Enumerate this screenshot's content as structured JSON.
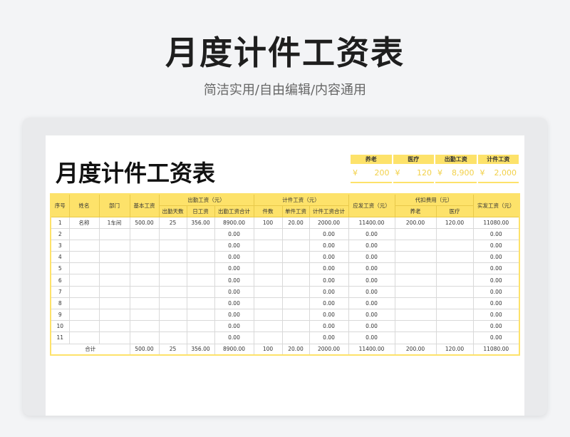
{
  "page": {
    "title": "月度计件工资表",
    "subtitle": "简洁实用/自由编辑/内容通用"
  },
  "sheet": {
    "title": "月度计件工资表",
    "summary": {
      "labels": [
        "养老",
        "医疗",
        "出勤工资",
        "计件工资"
      ],
      "currency": "¥",
      "values": [
        "200",
        "120",
        "8,900",
        "2,000"
      ]
    }
  },
  "table": {
    "headers": {
      "seq": "序号",
      "name": "姓名",
      "dept": "部门",
      "base": "基本工资",
      "attendance_group": "出勤工资（元）",
      "att_days": "出勤天数",
      "daily": "日工资",
      "att_total": "出勤工资合计",
      "piece_group": "计件工资（元）",
      "pieces": "件数",
      "unit": "单件工资",
      "piece_total": "计件工资合计",
      "gross": "应发工资（元）",
      "deduct_group": "代扣费用（元）",
      "pension": "养老",
      "medical": "医疗",
      "net": "实发工资（元）"
    },
    "rows": [
      [
        "1",
        "名称",
        "1车间",
        "500.00",
        "25",
        "356.00",
        "8900.00",
        "100",
        "20.00",
        "2000.00",
        "11400.00",
        "200.00",
        "120.00",
        "11080.00"
      ],
      [
        "2",
        "",
        "",
        "",
        "",
        "",
        "0.00",
        "",
        "",
        "0.00",
        "0.00",
        "",
        "",
        "0.00"
      ],
      [
        "3",
        "",
        "",
        "",
        "",
        "",
        "0.00",
        "",
        "",
        "0.00",
        "0.00",
        "",
        "",
        "0.00"
      ],
      [
        "4",
        "",
        "",
        "",
        "",
        "",
        "0.00",
        "",
        "",
        "0.00",
        "0.00",
        "",
        "",
        "0.00"
      ],
      [
        "5",
        "",
        "",
        "",
        "",
        "",
        "0.00",
        "",
        "",
        "0.00",
        "0.00",
        "",
        "",
        "0.00"
      ],
      [
        "6",
        "",
        "",
        "",
        "",
        "",
        "0.00",
        "",
        "",
        "0.00",
        "0.00",
        "",
        "",
        "0.00"
      ],
      [
        "7",
        "",
        "",
        "",
        "",
        "",
        "0.00",
        "",
        "",
        "0.00",
        "0.00",
        "",
        "",
        "0.00"
      ],
      [
        "8",
        "",
        "",
        "",
        "",
        "",
        "0.00",
        "",
        "",
        "0.00",
        "0.00",
        "",
        "",
        "0.00"
      ],
      [
        "9",
        "",
        "",
        "",
        "",
        "",
        "0.00",
        "",
        "",
        "0.00",
        "0.00",
        "",
        "",
        "0.00"
      ],
      [
        "10",
        "",
        "",
        "",
        "",
        "",
        "0.00",
        "",
        "",
        "0.00",
        "0.00",
        "",
        "",
        "0.00"
      ],
      [
        "11",
        "",
        "",
        "",
        "",
        "",
        "0.00",
        "",
        "",
        "0.00",
        "0.00",
        "",
        "",
        "0.00"
      ]
    ],
    "total": {
      "label": "合计",
      "values": [
        "500.00",
        "25",
        "356.00",
        "8900.00",
        "100",
        "20.00",
        "2000.00",
        "11400.00",
        "200.00",
        "120.00",
        "11080.00"
      ]
    }
  },
  "colors": {
    "accent": "#fde26a",
    "background": "#f3f4f6"
  }
}
